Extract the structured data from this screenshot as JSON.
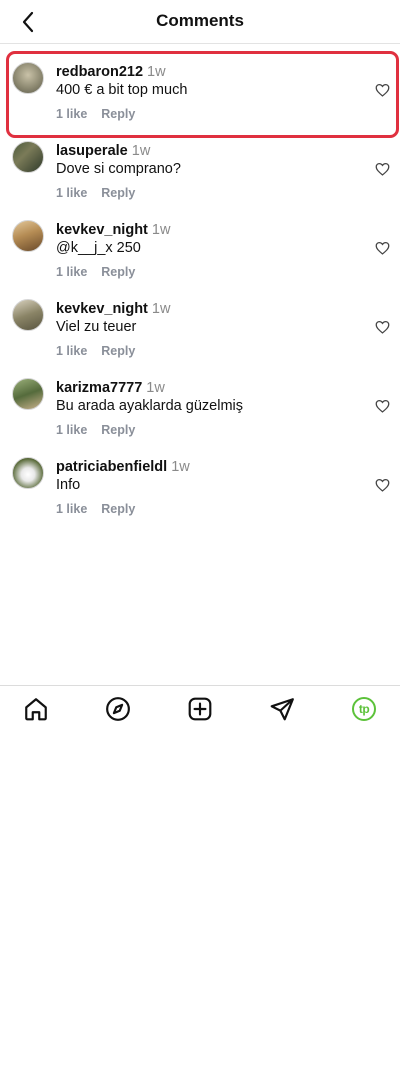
{
  "header": {
    "title": "Comments",
    "back_icon": "chevron-left-icon"
  },
  "comments": [
    {
      "username": "redbaron212",
      "time": "1w",
      "text": "400 € a bit top much",
      "likes": "1 like",
      "reply": "Reply",
      "highlighted": true
    },
    {
      "username": "lasuperale",
      "time": "1w",
      "text": "Dove si comprano?",
      "likes": "1 like",
      "reply": "Reply"
    },
    {
      "username": "kevkev_night",
      "time": "1w",
      "text": "@k__j_x 250",
      "likes": "1 like",
      "reply": "Reply"
    },
    {
      "username": "kevkev_night",
      "time": "1w",
      "text": "Viel zu teuer",
      "likes": "1 like",
      "reply": "Reply"
    },
    {
      "username": "karizma7777",
      "time": "1w",
      "text": "Bu arada ayaklarda güzelmiş",
      "likes": "1 like",
      "reply": "Reply"
    },
    {
      "username": "patriciabenfieldl",
      "time": "1w",
      "text": "Info",
      "likes": "1 like",
      "reply": "Reply"
    }
  ],
  "tabbar": {
    "items": [
      "home-icon",
      "compass-icon",
      "plus-square-icon",
      "send-icon",
      "profile-icon"
    ],
    "profile_badge": "tp",
    "profile_color": "#5cc23a"
  },
  "colors": {
    "highlight": "#e0303f",
    "meta": "#8a8f99"
  }
}
